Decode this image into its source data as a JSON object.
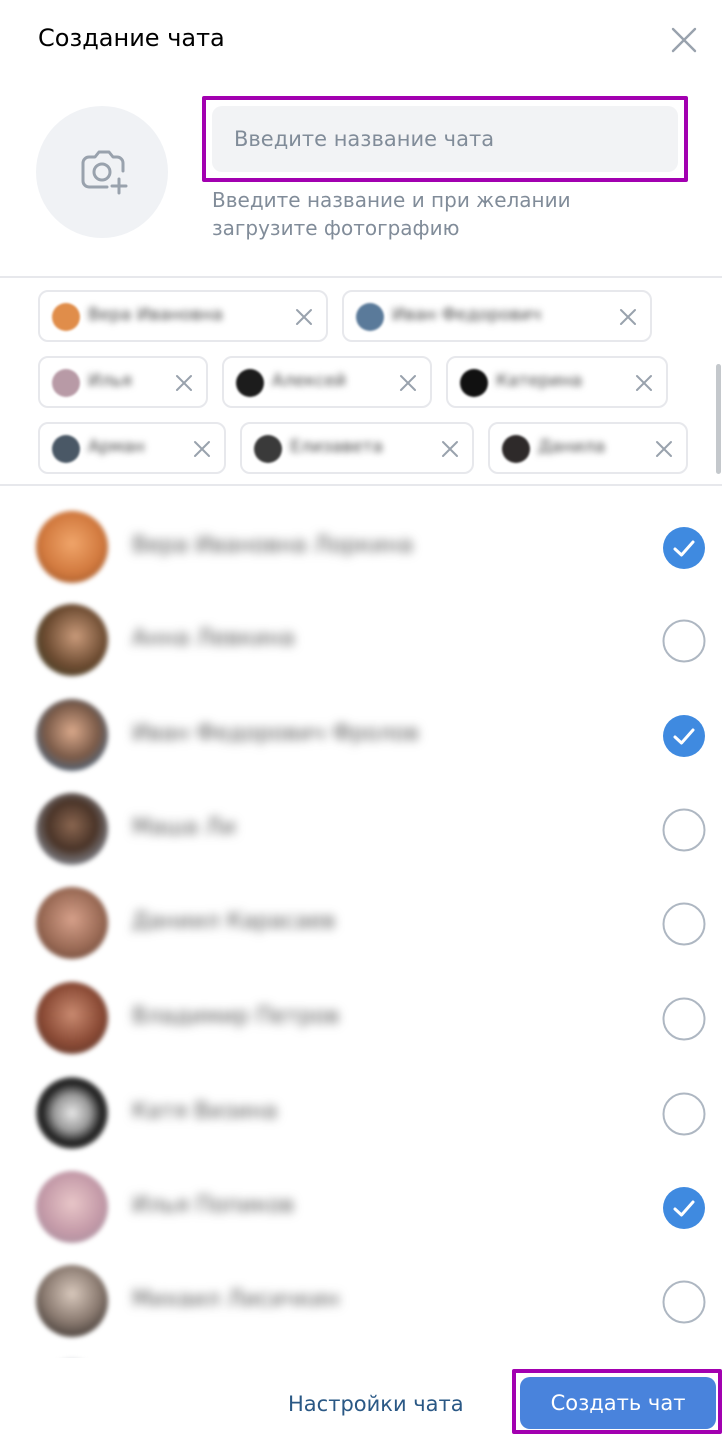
{
  "header": {
    "title": "Создание чата",
    "close_icon": "close-icon"
  },
  "chat_name": {
    "placeholder": "Введите название чата",
    "value": "",
    "hint_line1": "Введите название и при желании",
    "hint_line2": "загрузите фотографию",
    "photo_icon": "camera-plus-icon"
  },
  "selected_chips": [
    {
      "name": "Вера Ивановна"
    },
    {
      "name": "Иван Федорович"
    },
    {
      "name": "Илья"
    },
    {
      "name": "Алексей"
    },
    {
      "name": "Катерина"
    },
    {
      "name": "Арман"
    },
    {
      "name": "Елизавета"
    },
    {
      "name": "Данила"
    }
  ],
  "contacts": [
    {
      "name": "Вера Ивановна Лоркина",
      "selected": true
    },
    {
      "name": "Анна Левкина",
      "selected": false
    },
    {
      "name": "Иван Федорович Фролов",
      "selected": true
    },
    {
      "name": "Маша Ли",
      "selected": false
    },
    {
      "name": "Даниил Карасаев",
      "selected": false
    },
    {
      "name": "Владимир Петров",
      "selected": false
    },
    {
      "name": "Катя Визина",
      "selected": false
    },
    {
      "name": "Илья Попиков",
      "selected": true
    },
    {
      "name": "Михаил Лисичкин",
      "selected": false
    }
  ],
  "footer": {
    "settings_label": "Настройки чата",
    "create_label": "Создать чат"
  },
  "colors": {
    "accent": "#4983dc",
    "check": "#3f8ae0",
    "highlight": "#a200b0",
    "link": "#2a5885"
  }
}
